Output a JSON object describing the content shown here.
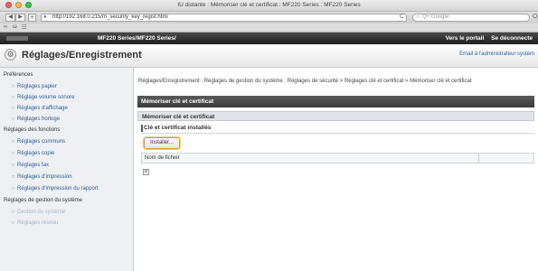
{
  "window": {
    "title": "IU distante : Mémoriser clé et certificat : MF220 Series : MF220 Series"
  },
  "toolbar": {
    "back": "◀",
    "forward": "▶",
    "add": "+",
    "url": "http://192.168.0.215/m_security_key_regist.html",
    "search_placeholder": "Q+ Google",
    "reload": "C",
    "right_glyph": "O",
    "bookmarks": [
      "∞",
      "ω",
      "☷"
    ]
  },
  "brandbar": {
    "model_path": "MF220 Series/MF220 Series/",
    "portal_link": "Vers le portail",
    "logout_link": "Se déconnecte"
  },
  "header": {
    "title": "Réglages/Enregistrement",
    "admin_email": "Email à l'administrateur systèm"
  },
  "sidebar": {
    "group1": "Préférences",
    "group1_items": [
      "Réglages papier",
      "Réglage volume sonore",
      "Réglages d'affichage",
      "Réglages horloge"
    ],
    "group2": "Réglages des fonctions",
    "group2_items": [
      "Réglages communs",
      "Réglages copie",
      "Réglages fax",
      "Réglages d'impression",
      "Réglages d'impression du rapport"
    ],
    "group3": "Réglages de gestion du système",
    "group3_items": [
      "Gestion du système",
      "Réglages réseau"
    ]
  },
  "main": {
    "breadcrumb": "Réglages/Enregistrement : Réglages de gestion du système : Réglages de sécurité > Réglages clé et certificat > Mémoriser clé et certificat",
    "header1": "Mémoriser clé et certificat",
    "header2": "Mémoriser clé et certificat",
    "section_title": "Clé et certificat installés",
    "install_button": "Installer...",
    "table_column_filename": "Nom de fichier",
    "pager_icon": "≡"
  }
}
